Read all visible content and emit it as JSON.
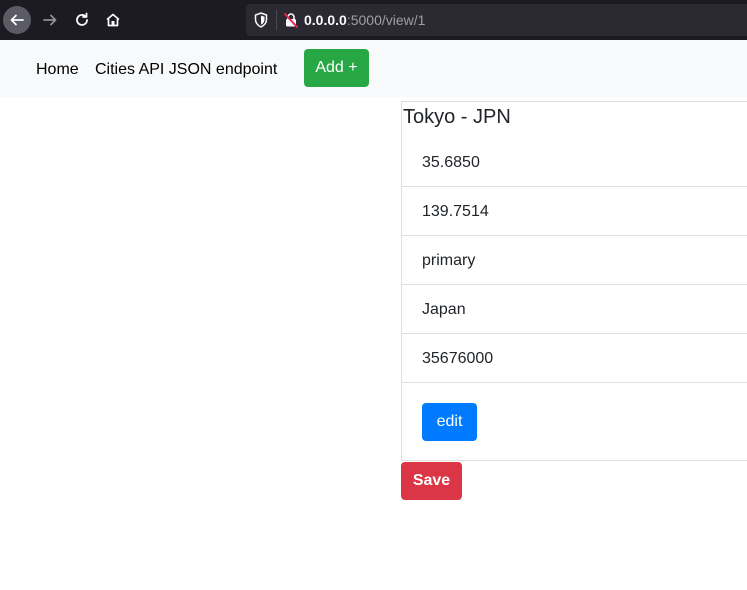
{
  "browser": {
    "url_host": "0.0.0.0",
    "url_path": ":5000/view/1",
    "icons": [
      "back-arrow-icon",
      "forward-arrow-icon",
      "reload-icon",
      "home-icon",
      "shield-icon",
      "insecure-lock-icon"
    ]
  },
  "nav": {
    "home_label": "Home",
    "api_label": "Cities API JSON endpoint",
    "add_label": "Add +"
  },
  "card": {
    "title": "Tokyo - JPN",
    "lat": "35.6850",
    "lng": "139.7514",
    "capital": "primary",
    "country": "Japan",
    "population": "35676000",
    "edit_label": "edit"
  },
  "save_label": "Save",
  "colors": {
    "add_button": "#28a745",
    "edit_button": "#007bff",
    "save_button": "#dc3545",
    "navbar_bg": "#f8f9fa",
    "browser_chrome": "#1c1b22"
  }
}
